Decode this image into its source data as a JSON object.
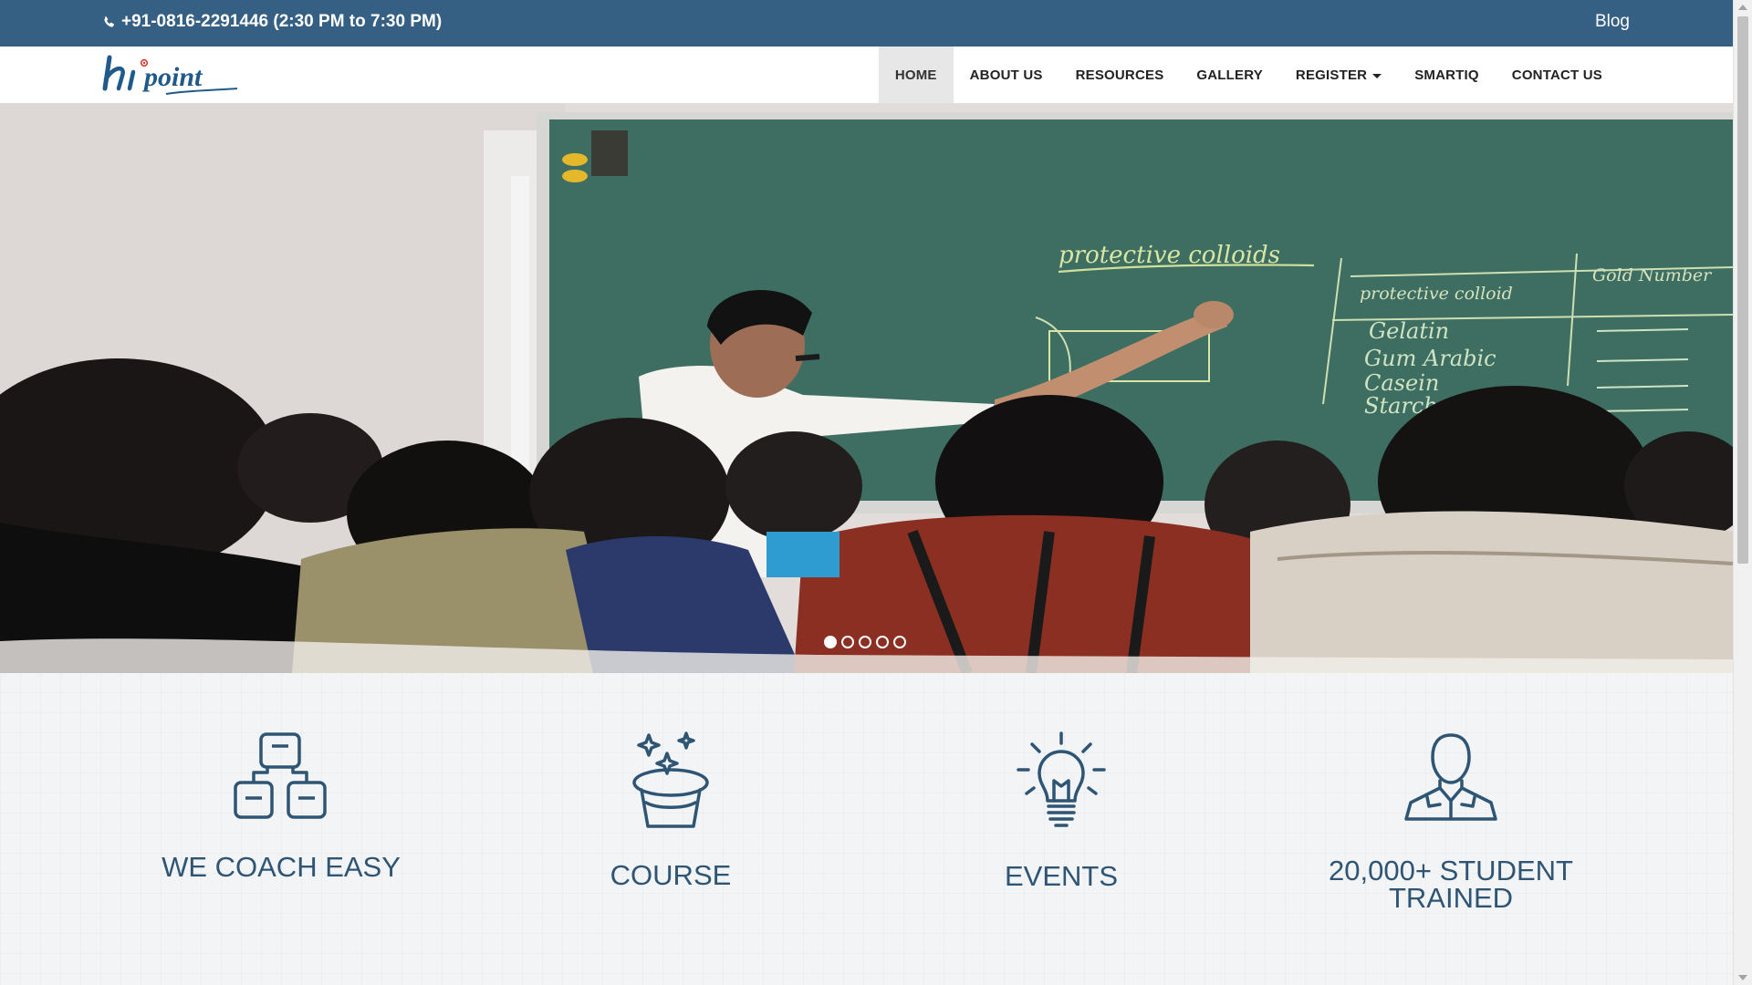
{
  "topbar": {
    "phone": "+91-0816-2291446 (2:30 PM to 7:30 PM)",
    "blog": "Blog",
    "phone_icon": "phone-icon"
  },
  "logo": {
    "text": "hipoint"
  },
  "nav": {
    "items": [
      {
        "label": "HOME",
        "active": true
      },
      {
        "label": "ABOUT US"
      },
      {
        "label": "RESOURCES"
      },
      {
        "label": "GALLERY"
      },
      {
        "label": "REGISTER",
        "dropdown": true
      },
      {
        "label": "SMARTIQ"
      },
      {
        "label": "CONTACT US"
      }
    ]
  },
  "hero": {
    "chalkboard_heading": "protective colloids",
    "table_col1": "protective colloid",
    "table_col2": "Gold Number",
    "table_rows": [
      "Gelatin",
      "Gum Arabic",
      "Casein",
      "Starch"
    ],
    "slides": 5,
    "active_slide": 1
  },
  "features": [
    {
      "label": "WE COACH EASY",
      "icon": "blocks-icon"
    },
    {
      "label": "COURSE",
      "icon": "magic-hat-icon"
    },
    {
      "label": "EVENTS",
      "icon": "lightbulb-icon"
    },
    {
      "label_line1": "20,000+ STUDENT",
      "label_line2": "TRAINED",
      "icon": "student-icon"
    }
  ],
  "colors": {
    "topbar": "#365f84",
    "accent": "#2f5575",
    "nav_active_bg": "#e7e7e7",
    "chalkboard": "#3d6e61"
  }
}
